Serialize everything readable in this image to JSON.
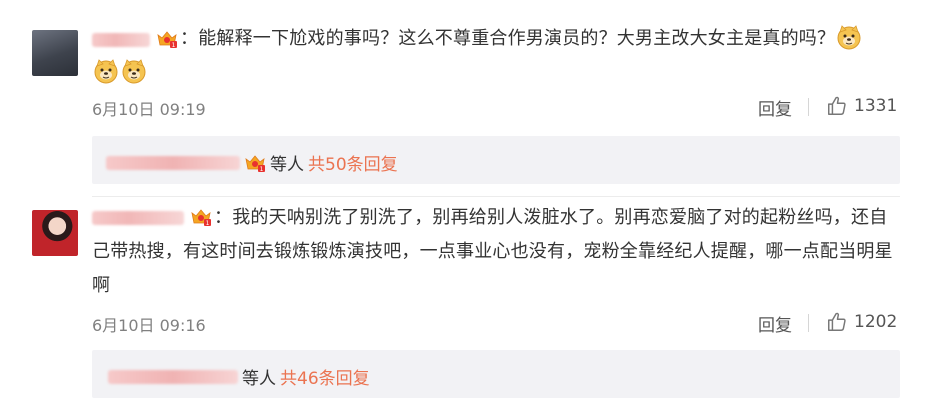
{
  "comments": [
    {
      "text": "：能解释一下尬戏的事吗？这么不尊重合作男演员的？大男主改大女主是真的吗？",
      "time": "6月10日 09:19",
      "reply_label": "回复",
      "likes": "1331",
      "sub_replies": {
        "who": "等人",
        "count": "共50条回复"
      },
      "emoji_icon": "doge-emoji",
      "colors": {
        "accent": "#eb7350"
      }
    },
    {
      "text": "：我的天呐别洗了别洗了，别再给别人泼脏水了。别再恋爱脑了对的起粉丝吗，还自己带热搜，有这时间去锻炼锻炼演技吧，一点事业心也没有，宠粉全靠经纪人提醒，哪一点配当明星啊",
      "time": "6月10日 09:16",
      "reply_label": "回复",
      "likes": "1202",
      "sub_replies": {
        "who": "等人",
        "count": "共46条回复"
      }
    }
  ]
}
